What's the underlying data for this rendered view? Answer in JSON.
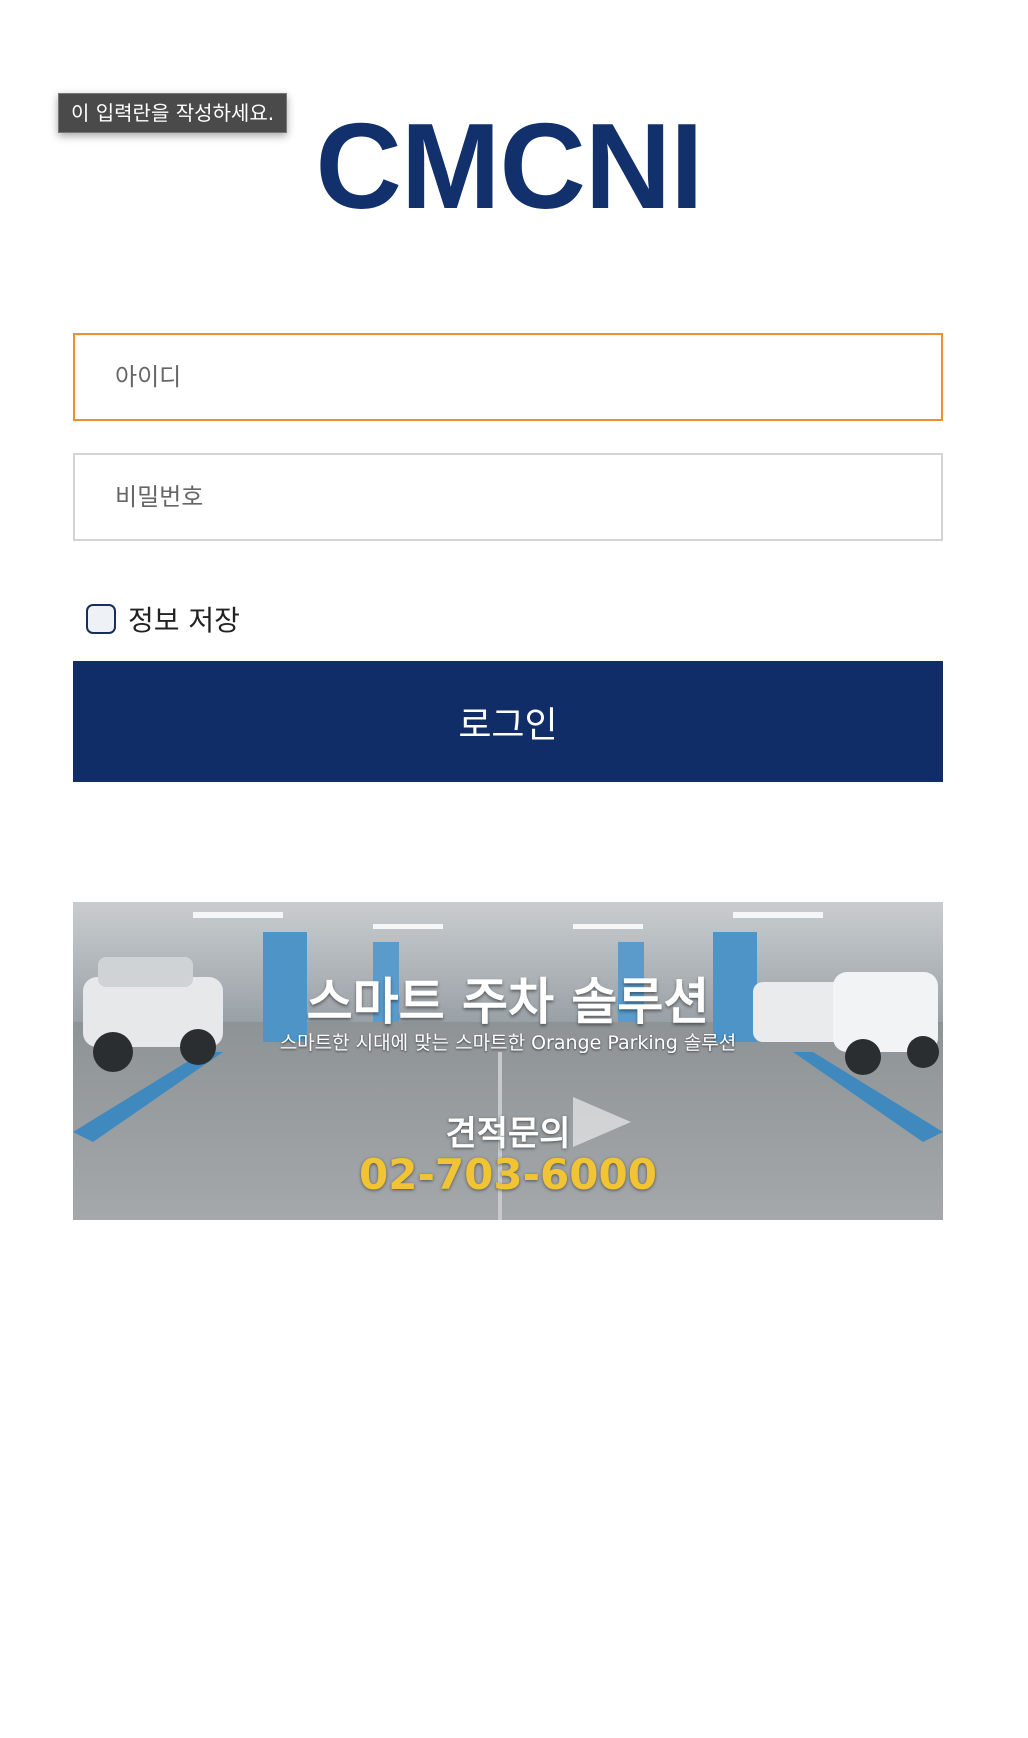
{
  "tooltip": {
    "text": "이 입력란을 작성하세요."
  },
  "logo": {
    "text": "CMCNI"
  },
  "login_form": {
    "id_placeholder": "아이디",
    "password_placeholder": "비밀번호",
    "remember_label": "정보 저장",
    "remember_checked": false,
    "login_button_label": "로그인"
  },
  "banner": {
    "title": "스마트 주차 솔루션",
    "subtitle": "스마트한 시대에 맞는 스마트한 Orange Parking 솔루션",
    "inquiry_label": "견적문의",
    "phone": "02-703-6000"
  },
  "colors": {
    "brand_navy": "#112d68",
    "focus_orange": "#ef8f2f",
    "phone_yellow": "#f2c332"
  }
}
